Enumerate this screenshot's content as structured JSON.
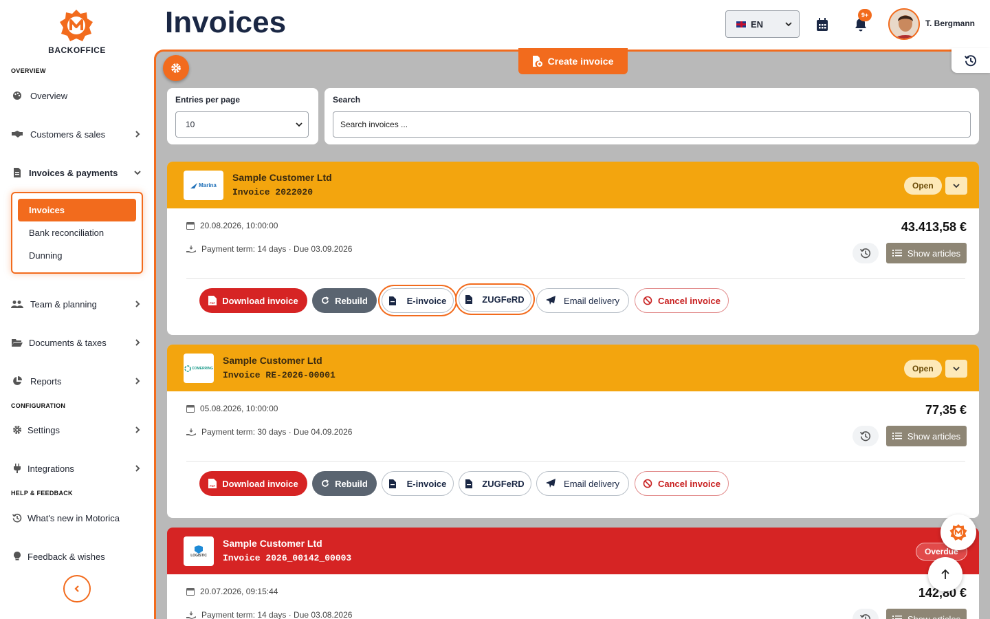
{
  "brand": {
    "name": "BACKOFFICE",
    "accent": "#f26b1d"
  },
  "sidebar": {
    "sections": {
      "overview": "OVERVIEW",
      "configuration": "CONFIGURATION",
      "help": "HELP & FEEDBACK"
    },
    "items": {
      "overview": "Overview",
      "customers": "Customers & sales",
      "invoices_payments": "Invoices & payments",
      "team": "Team & planning",
      "documents": "Documents & taxes",
      "reports": "Reports",
      "settings": "Settings",
      "integrations": "Integrations",
      "whats_new": "What's new in Motorica",
      "feedback": "Feedback & wishes"
    },
    "subitems": {
      "invoices": "Invoices",
      "bank": "Bank reconciliation",
      "dunning": "Dunning"
    }
  },
  "header": {
    "title": "Invoices",
    "language": "EN",
    "notifications": "9+",
    "user": "T. Bergmann"
  },
  "toolbar": {
    "create_label": "Create invoice"
  },
  "filters": {
    "entries_label": "Entries per page",
    "entries_value": "10",
    "search_label": "Search",
    "search_placeholder": "Search invoices ..."
  },
  "actions": {
    "download": "Download invoice",
    "rebuild": "Rebuild",
    "einvoice": "E-invoice",
    "zugferd": "ZUGFeRD",
    "email": "Email delivery",
    "cancel": "Cancel invoice",
    "show_articles": "Show articles"
  },
  "invoices": [
    {
      "customer": "Sample Customer Ltd",
      "number": "Invoice 2022020",
      "status": "Open",
      "logo_text": "Marina",
      "date": "20.08.2026, 10:00:00",
      "term": "Payment term: 14 days · Due 03.09.2026",
      "amount": "43.413,58 €"
    },
    {
      "customer": "Sample Customer Ltd",
      "number": "Invoice RE-2026-00001",
      "status": "Open",
      "logo_text": "COMERRING",
      "date": "05.08.2026, 10:00:00",
      "term": "Payment term: 30 days · Due 04.09.2026",
      "amount": "77,35 €"
    },
    {
      "customer": "Sample Customer Ltd",
      "number": "Invoice 2026_00142_00003",
      "status": "Overdue",
      "logo_text": "LOGISTIC",
      "date": "20.07.2026, 09:15:44",
      "term": "Payment term: 14 days · Due 03.08.2026",
      "amount": "142,80 €"
    }
  ],
  "colors": {
    "open_header": "#f3a50e",
    "overdue_header": "#d62424",
    "download_button": "#d62424",
    "rebuild_button": "#5a6470",
    "articles_button": "#8e8675"
  }
}
